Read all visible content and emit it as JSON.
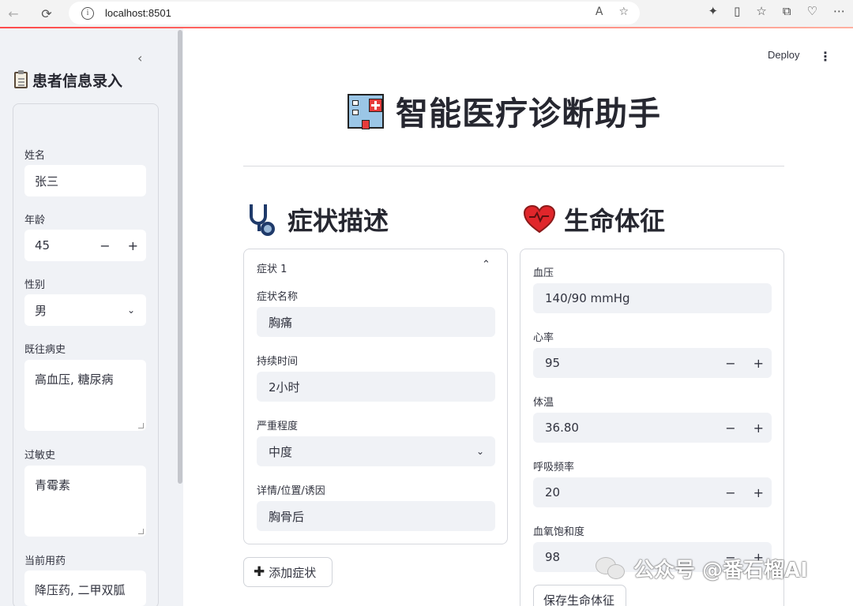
{
  "browser": {
    "url": "localhost:8501"
  },
  "header": {
    "deploy_label": "Deploy",
    "menu_icon": "vertical-dots-icon"
  },
  "sidebar": {
    "title": "患者信息录入",
    "title_icon": "clipboard-icon",
    "fields": {
      "name": {
        "label": "姓名",
        "value": "张三"
      },
      "age": {
        "label": "年龄",
        "value": "45"
      },
      "gender": {
        "label": "性别",
        "value": "男"
      },
      "history": {
        "label": "既往病史",
        "value": "高血压, 糖尿病"
      },
      "allergy": {
        "label": "过敏史",
        "value": "青霉素"
      },
      "medication": {
        "label": "当前用药",
        "value": "降压药, 二甲双胍"
      }
    }
  },
  "main": {
    "title": "智能医疗诊断助手",
    "title_icon": "hospital-icon",
    "symptoms": {
      "heading": "症状描述",
      "heading_icon": "stethoscope-icon",
      "expander_label": "症状 1",
      "name_label": "症状名称",
      "name_value": "胸痛",
      "duration_label": "持续时间",
      "duration_value": "2小时",
      "severity_label": "严重程度",
      "severity_value": "中度",
      "detail_label": "详情/位置/诱因",
      "detail_value": "胸骨后",
      "add_button": "添加症状"
    },
    "vitals": {
      "heading": "生命体征",
      "heading_icon": "heart-icon",
      "bp_label": "血压",
      "bp_value": "140/90 mmHg",
      "hr_label": "心率",
      "hr_value": "95",
      "temp_label": "体温",
      "temp_value": "36.80",
      "resp_label": "呼吸频率",
      "resp_value": "20",
      "spo2_label": "血氧饱和度",
      "spo2_value": "98",
      "save_button": "保存生命体征"
    }
  },
  "watermark": {
    "text": "公众号 @番石榴AI"
  },
  "colors": {
    "sidebar_bg": "#f0f2f6",
    "accent": "#ff4b4b",
    "text": "#31333f"
  }
}
